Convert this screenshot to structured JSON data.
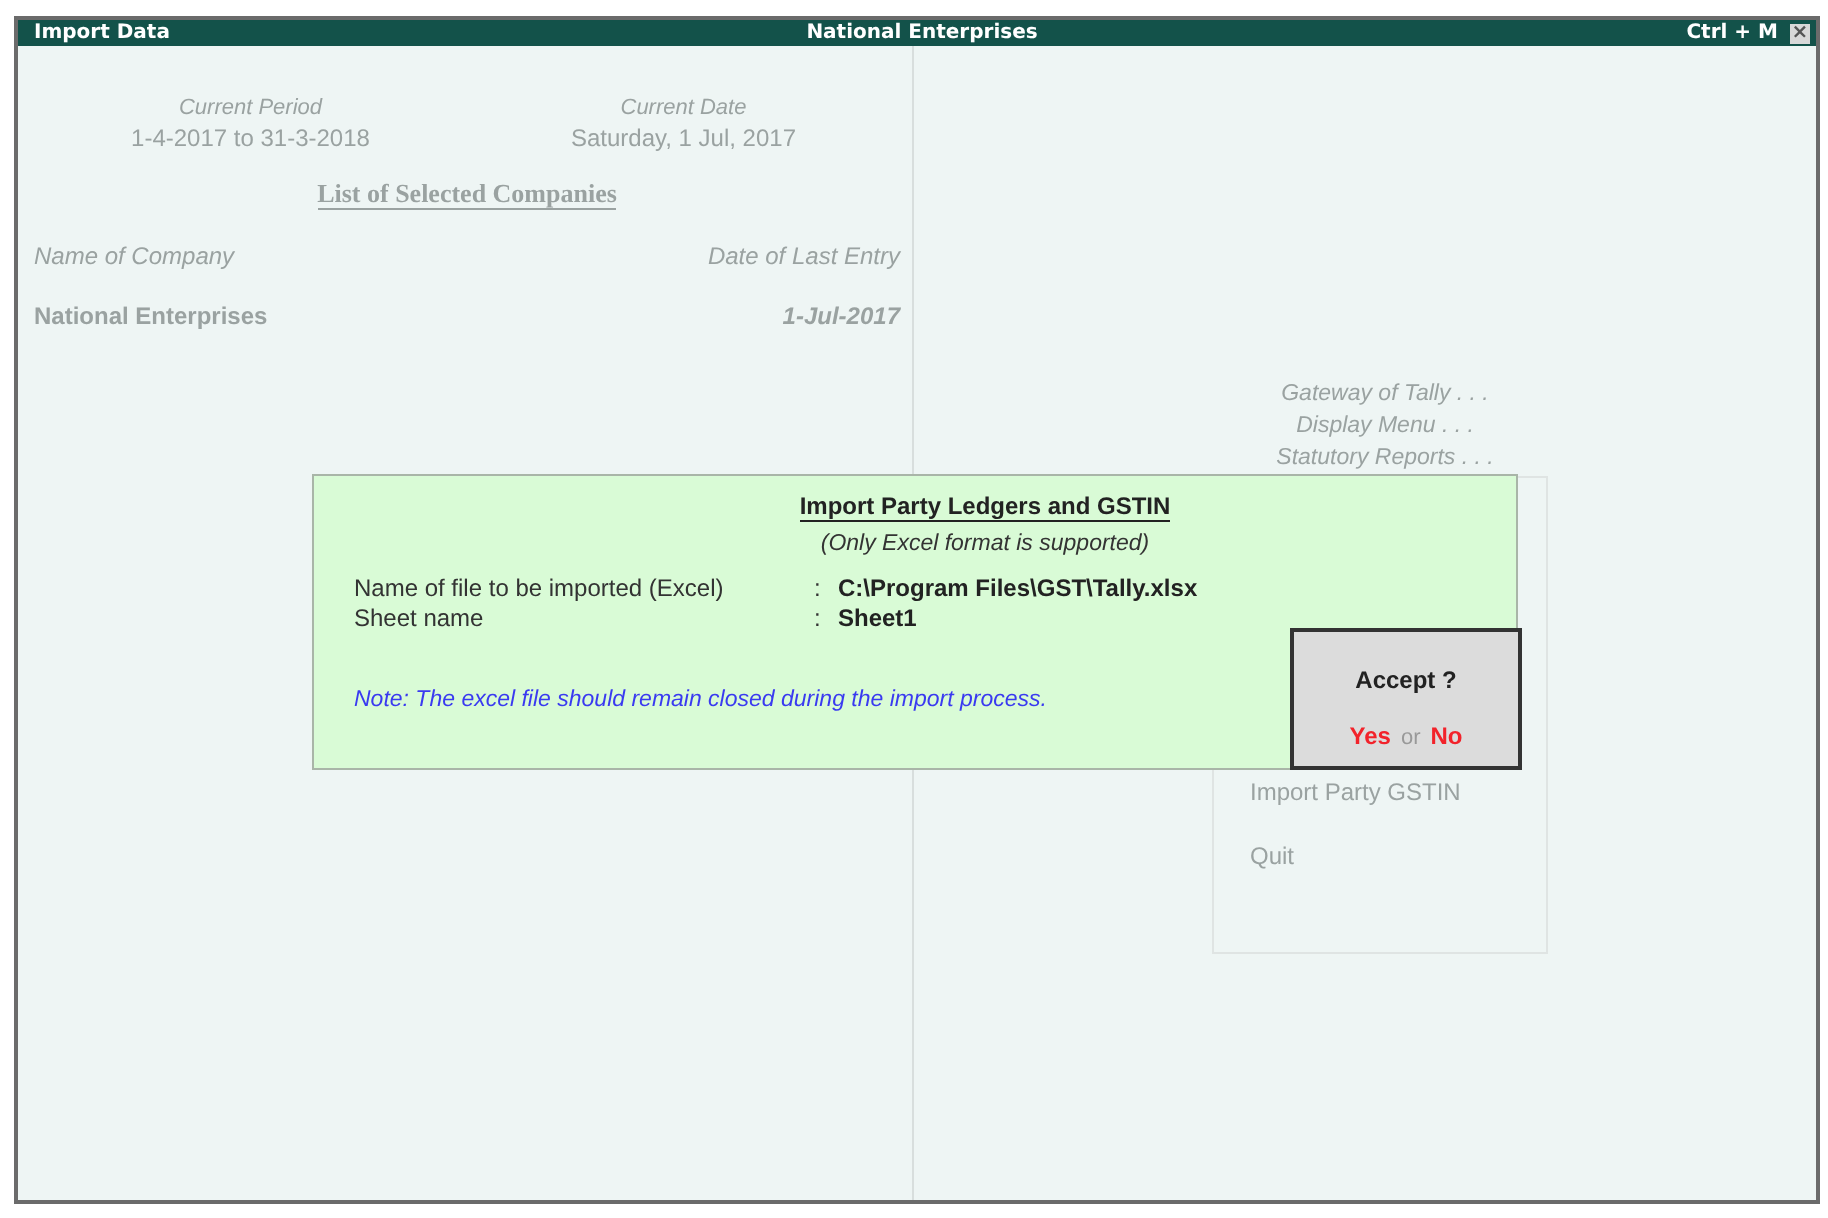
{
  "window": {
    "title": "Import Data",
    "company": "National Enterprises",
    "shortcut": "Ctrl + M",
    "close": "×"
  },
  "left_pane": {
    "period_label": "Current Period",
    "period": "1-4-2017 to 31-3-2018",
    "date_label": "Current Date",
    "date": "Saturday, 1 Jul, 2017",
    "list_title": "List of Selected Companies",
    "columns": [
      "Name of Company",
      "Date of Last Entry"
    ],
    "rows": [
      {
        "name": "National Enterprises",
        "last_entry": "1-Jul-2017"
      }
    ]
  },
  "right_pane": {
    "breadcrumbs": [
      "Gateway of Tally . . .",
      "Display Menu . . .",
      "Statutory Reports . . ."
    ],
    "menu_items": [
      "Import Party GSTIN",
      "Quit"
    ]
  },
  "dialog": {
    "title": "Import Party Ledgers and GSTIN",
    "subtitle": "(Only Excel format is supported)",
    "fields": [
      {
        "label": "Name of file to be imported (Excel)",
        "separator": ":",
        "value": "C:\\Program Files\\GST\\Tally.xlsx"
      },
      {
        "label": "Sheet name",
        "separator": ":",
        "value": "Sheet1"
      }
    ],
    "note": "Note: The excel file should remain closed during the import process."
  },
  "accept": {
    "question": "Accept ?",
    "yes": "Yes",
    "or": "or",
    "no": "No"
  }
}
